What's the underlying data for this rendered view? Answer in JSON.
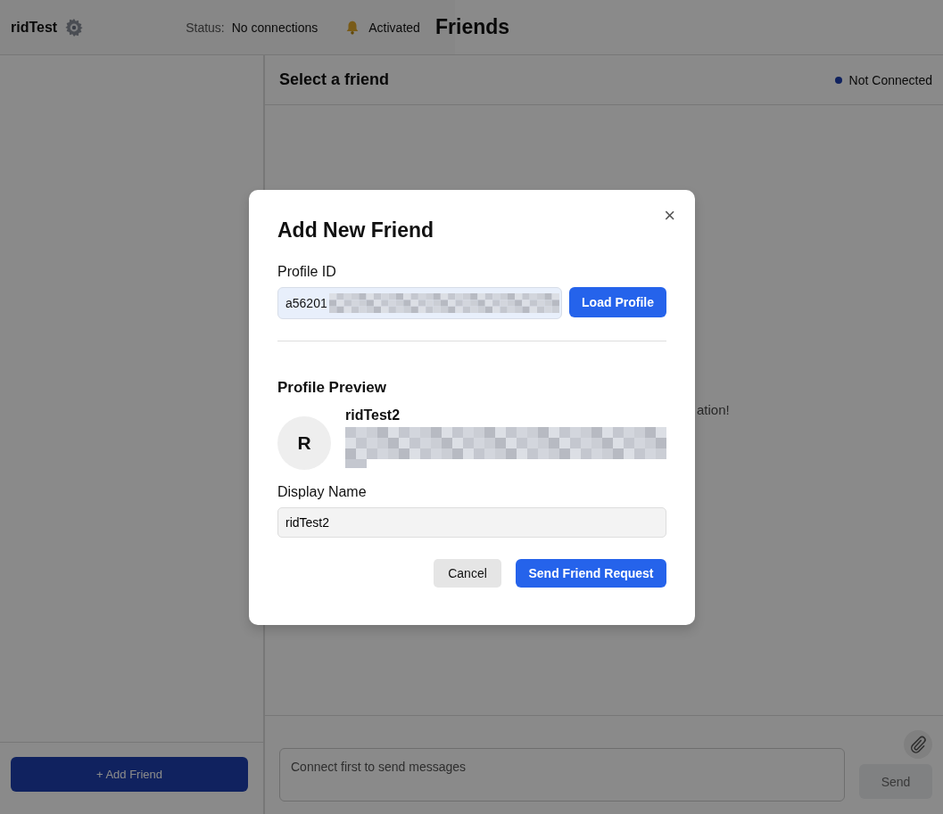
{
  "header": {
    "username": "ridTest",
    "status_label": "Status:",
    "status_value": "No connections",
    "notification": "Activated",
    "title": "Friends"
  },
  "sidebar": {
    "add_button": "+ Add Friend"
  },
  "chat": {
    "heading": "Select a friend",
    "connection": {
      "label": "Not Connected",
      "connected": false
    },
    "empty_text": "ation!",
    "composer": {
      "placeholder": "Connect first to send messages"
    },
    "send": {
      "label": "Send",
      "disabled": true
    }
  },
  "modal": {
    "title": "Add New Friend",
    "close": "×",
    "profile_id_label": "Profile ID",
    "profile_id_value": "a56201",
    "load_button": "Load Profile",
    "preview_heading": "Profile Preview",
    "avatar_initial": "R",
    "profile_name": "ridTest2",
    "display_name_label": "Display Name",
    "display_name_value": "ridTest2",
    "cancel_button": "Cancel",
    "submit_button": "Send Friend Request"
  }
}
